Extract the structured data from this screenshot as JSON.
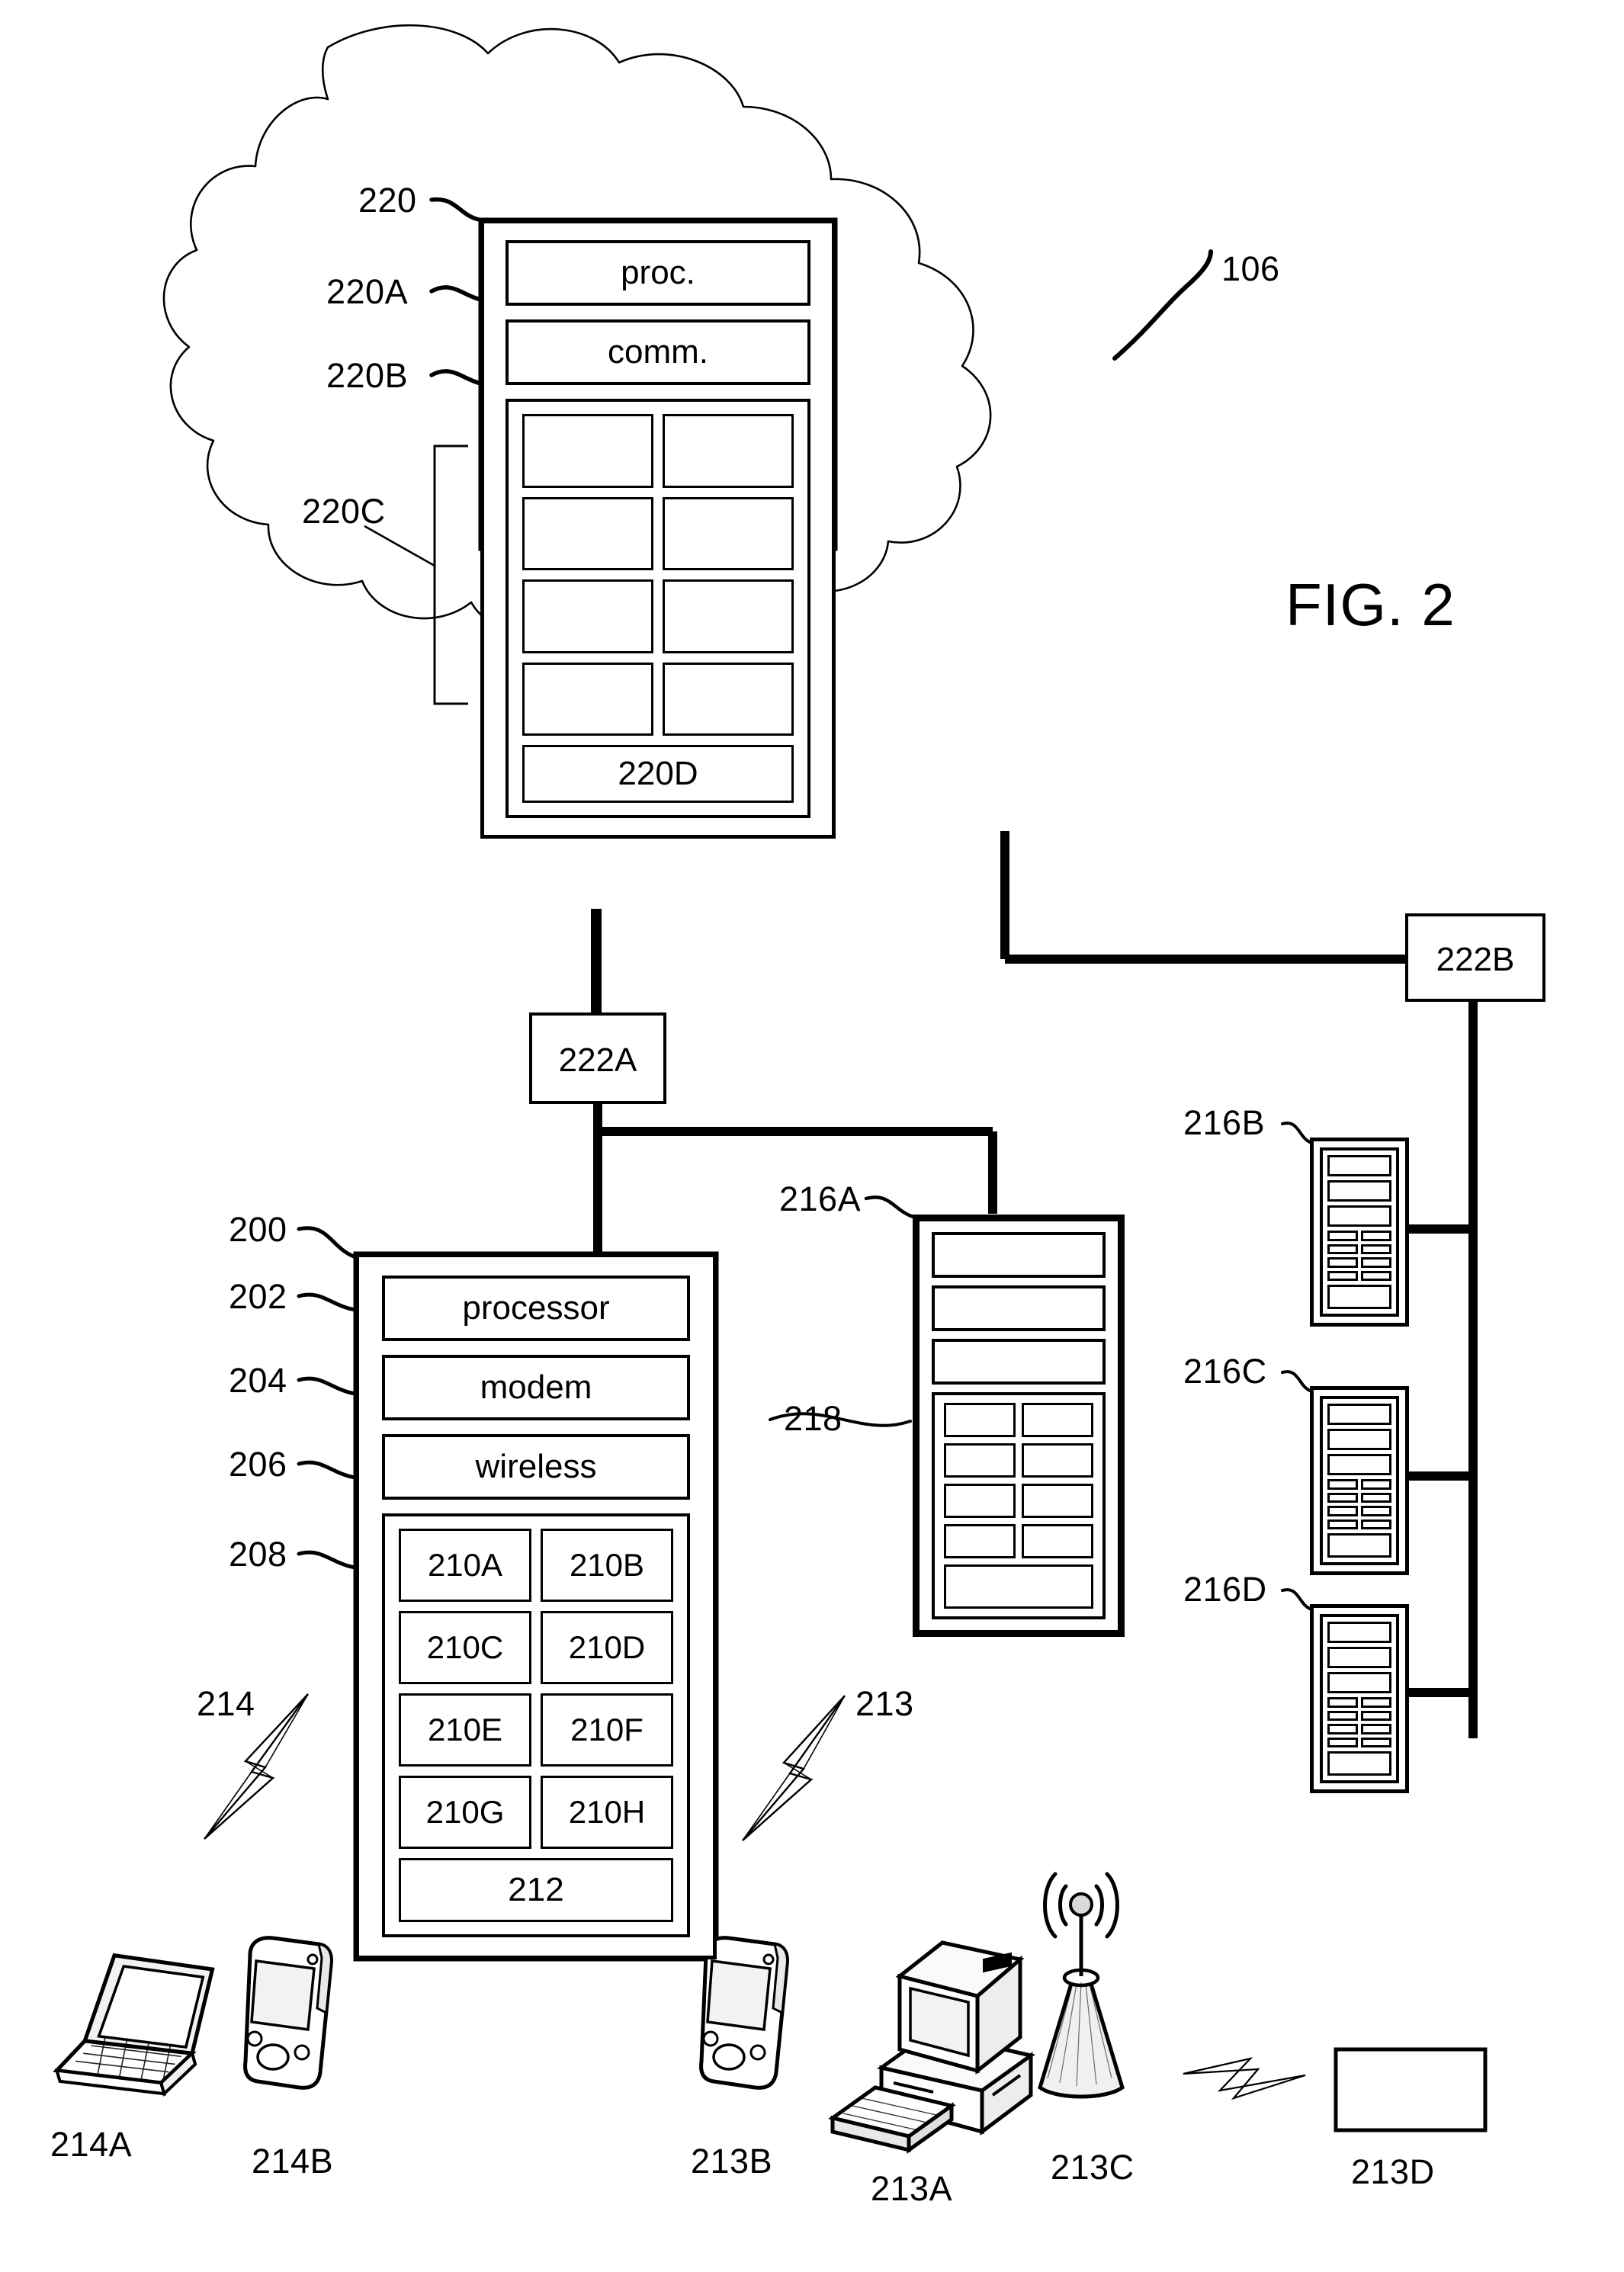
{
  "figure": {
    "title": "FIG. 2",
    "cloud_ref": "106"
  },
  "cloud_system": {
    "ref": "220",
    "blocks": [
      {
        "ref": "220A",
        "label": "proc."
      },
      {
        "ref": "220B",
        "label": "comm."
      }
    ],
    "group_ref": "220C",
    "grid_cells": [
      "",
      "",
      "",
      "",
      "",
      "",
      "",
      ""
    ],
    "footer_cell": "220D"
  },
  "routers": {
    "a": "222A",
    "b": "222B"
  },
  "device_200": {
    "ref": "200",
    "components": [
      {
        "ref": "202",
        "label": "processor"
      },
      {
        "ref": "204",
        "label": "modem"
      },
      {
        "ref": "206",
        "label": "wireless"
      }
    ],
    "group_ref": "208",
    "grid_cells": [
      "210A",
      "210B",
      "210C",
      "210D",
      "210E",
      "210F",
      "210G",
      "210H"
    ],
    "footer_cell": "212"
  },
  "server_216a": {
    "ref": "216A",
    "inner_ref": "218",
    "top_rows": [
      "",
      "",
      ""
    ],
    "grid_cells": [
      "",
      "",
      "",
      "",
      "",
      "",
      "",
      ""
    ],
    "footer_cell": ""
  },
  "server_racks": [
    {
      "ref": "216B"
    },
    {
      "ref": "216C"
    },
    {
      "ref": "216D"
    }
  ],
  "wireless_links": [
    {
      "ref": "214"
    },
    {
      "ref": "213"
    }
  ],
  "client_devices_214": [
    {
      "ref": "214A",
      "icon": "laptop-icon"
    },
    {
      "ref": "214B",
      "icon": "pda-icon"
    }
  ],
  "client_devices_213": [
    {
      "ref": "213B",
      "icon": "pda-icon"
    },
    {
      "ref": "213A",
      "icon": "desktop-computer-icon"
    },
    {
      "ref": "213C",
      "icon": "antenna-tower-icon"
    },
    {
      "ref": "213D",
      "icon": "generic-box-icon"
    }
  ],
  "colors": {
    "ink": "#000000",
    "cloud_stroke": "#1a1a1a",
    "fill": "#ffffff"
  }
}
